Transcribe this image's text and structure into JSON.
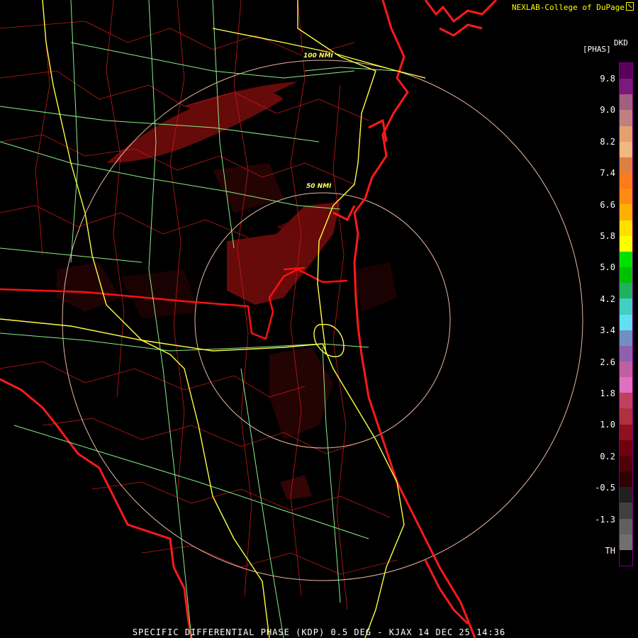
{
  "credit": "NEXLAB-College of DuPage",
  "legend": {
    "product": "DKD",
    "units": "[PHAS]",
    "ticks": [
      "9.8",
      "9.0",
      "8.2",
      "7.4",
      "6.6",
      "5.8",
      "5.0",
      "4.2",
      "3.4",
      "2.6",
      "1.8",
      "1.0",
      "0.2",
      "-0.5",
      "-1.3",
      "TH"
    ],
    "colors": [
      "#5a005a",
      "#7a1a7a",
      "#a06080",
      "#c08080",
      "#e6a070",
      "#f0b880",
      "#e08040",
      "#ff7a1a",
      "#ff8c10",
      "#ffb000",
      "#ffe000",
      "#ffff00",
      "#00e000",
      "#00c000",
      "#20b060",
      "#40d0c0",
      "#60e0f0",
      "#7090c0",
      "#9060b0",
      "#c060a0",
      "#e070c0",
      "#c04060",
      "#b03040",
      "#901020",
      "#700010",
      "#500008",
      "#300000",
      "#202020",
      "#404040",
      "#606060",
      "#707070",
      "#000000"
    ],
    "border_color": "#7a007a"
  },
  "range_rings": [
    {
      "label": "50 NMI"
    },
    {
      "label": "100 NMI"
    }
  ],
  "title": "SPECIFIC DIFFERENTIAL PHASE (KDP) 0.5 DEG - KJAX 14 DEC 25 14:36",
  "colors": {
    "state_border": "#ff1010",
    "county_border": "#c81818",
    "highway": "#ffff40",
    "road": "#88ee88",
    "ring": "#e8b8a0",
    "echo": "#7a0c0c"
  }
}
